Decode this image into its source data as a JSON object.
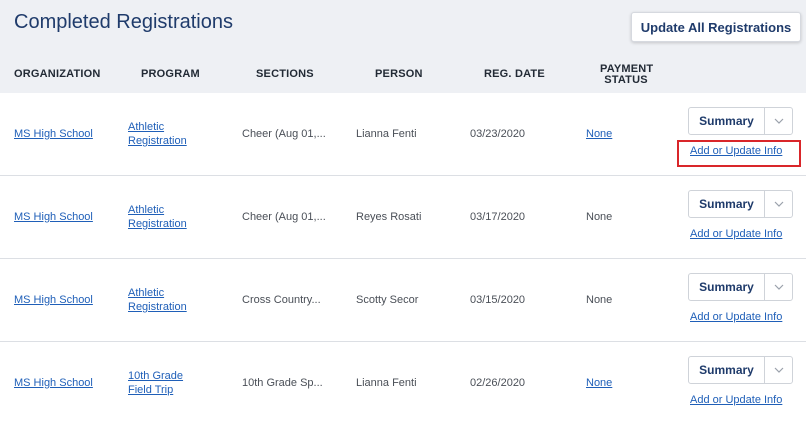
{
  "header": {
    "title": "Completed Registrations",
    "update_all_label": "Update All Registrations"
  },
  "columns": {
    "organization": "ORGANIZATION",
    "program": "PROGRAM",
    "sections": "SECTIONS",
    "person": "PERSON",
    "reg_date": "REG. DATE",
    "payment_status_line1": "PAYMENT",
    "payment_status_line2": "STATUS"
  },
  "rows": [
    {
      "organization": "MS High School",
      "program_line1": "Athletic",
      "program_line2": "Registration",
      "sections": "Cheer (Aug 01,...",
      "person": "Lianna Fenti",
      "reg_date": "03/23/2020",
      "payment_status": "None",
      "payment_is_link": true,
      "summary_label": "Summary",
      "add_update_label": "Add or Update Info"
    },
    {
      "organization": "MS High School",
      "program_line1": "Athletic",
      "program_line2": "Registration",
      "sections": "Cheer (Aug 01,...",
      "person": "Reyes Rosati",
      "reg_date": "03/17/2020",
      "payment_status": "None",
      "payment_is_link": false,
      "summary_label": "Summary",
      "add_update_label": "Add or Update Info"
    },
    {
      "organization": "MS High School",
      "program_line1": "Athletic",
      "program_line2": "Registration",
      "sections": "Cross Country...",
      "person": "Scotty Secor",
      "reg_date": "03/15/2020",
      "payment_status": "None",
      "payment_is_link": false,
      "summary_label": "Summary",
      "add_update_label": "Add or Update Info"
    },
    {
      "organization": "MS High School",
      "program_line1": "10th Grade",
      "program_line2": "Field Trip",
      "sections": "10th Grade Sp...",
      "person": "Lianna Fenti",
      "reg_date": "02/26/2020",
      "payment_status": "None",
      "payment_is_link": true,
      "summary_label": "Summary",
      "add_update_label": "Add or Update Info"
    }
  ],
  "colors": {
    "title": "#1f3b6b",
    "link": "#1f5fb8",
    "header_bg": "#eef0f4",
    "highlight": "#d9262a"
  }
}
